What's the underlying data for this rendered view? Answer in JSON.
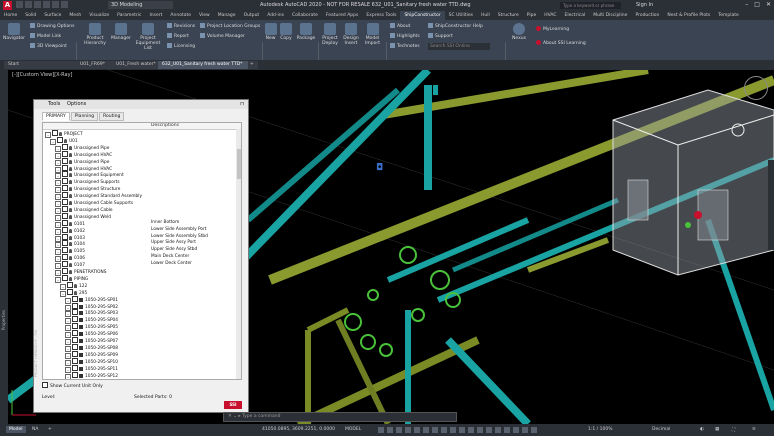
{
  "title_bar": {
    "workspace": "3D Modeling",
    "title": "Autodesk AutoCAD 2020 - NOT FOR RESALE    632_U01_Sanitary fresh water TTD.dwg",
    "search_placeholder": "Type a keyword or phrase",
    "sign_in": "Sign In"
  },
  "ribbon_tabs": [
    "Home",
    "Solid",
    "Surface",
    "Mesh",
    "Visualize",
    "Parametric",
    "Insert",
    "Annotate",
    "View",
    "Manage",
    "Output",
    "Add-ins",
    "Collaborate",
    "Featured Apps",
    "Express Tools",
    "ShipConstructor",
    "SC Utilities",
    "Hull",
    "Structure",
    "Pipe",
    "HVAC",
    "Electrical",
    "Multi Discipline",
    "Production",
    "Nest & Profile Plots",
    "Template"
  ],
  "active_tab": "ShipConstructor",
  "ribbon": {
    "navigator": "Navigator",
    "drawing_options": "Drawing Options",
    "model_link": "Model Link",
    "viewpoint_3d": "3D Viewpoint",
    "product_hierarchy": "Product Hierarchy",
    "manager": "Manager",
    "project_equipment_list": "Project Equipment List",
    "revisions": "Revisions",
    "report": "Report",
    "licensing": "Licensing",
    "project_location_groups": "Project Location Groups",
    "volume_manager": "Volume Manager",
    "new": "New",
    "copy": "Copy",
    "package": "Package",
    "project_deploy": "Project Deploy",
    "design_insert": "Design Insert",
    "model_import": "Model Import",
    "about": "About",
    "highlights": "Highlights",
    "technotes": "Technotes",
    "shipconstructor_help": "ShipConstructor Help",
    "support": "Support",
    "search_ssi_online": "Search SSI Online",
    "nexus": "Nexus",
    "mylearning": "MyLearning",
    "about_ssi_learning": "About SSI Learning",
    "panel_main": "Main",
    "panel_manage": "Manage",
    "panel_project": "Project",
    "panel_workshare": "WorkShare",
    "panel_help": "Help",
    "panel_ssi_learning": "SSI Learning"
  },
  "file_tabs": [
    "Start",
    "U01_FR69*",
    "U01_Fresh water*",
    "632_U01_Sanitary fresh water TTD*"
  ],
  "viewport_label": "[-][Custom View][X-Ray]",
  "left_strip_label": "Properties",
  "panel": {
    "menu_tools": "Tools",
    "menu_options": "Options",
    "tabs": [
      "PRIMARY",
      "Planning",
      "Routing"
    ],
    "col_desc": "Descriptions",
    "rows": [
      {
        "indent": 0,
        "name": "PROJECT",
        "desc": ""
      },
      {
        "indent": 1,
        "name": "U01",
        "desc": ""
      },
      {
        "indent": 2,
        "name": "Unassigned Pipe",
        "desc": ""
      },
      {
        "indent": 2,
        "name": "Unassigned HVAC",
        "desc": ""
      },
      {
        "indent": 2,
        "name": "Unassigned Pipe",
        "desc": ""
      },
      {
        "indent": 2,
        "name": "Unassigned HVAC",
        "desc": ""
      },
      {
        "indent": 2,
        "name": "Unassigned Equipment",
        "desc": ""
      },
      {
        "indent": 2,
        "name": "Unassigned Supports",
        "desc": ""
      },
      {
        "indent": 2,
        "name": "Unassigned Structure",
        "desc": ""
      },
      {
        "indent": 2,
        "name": "Unassigned Standard Assembly",
        "desc": ""
      },
      {
        "indent": 2,
        "name": "Unassigned Cable Supports",
        "desc": ""
      },
      {
        "indent": 2,
        "name": "Unassigned Cable",
        "desc": ""
      },
      {
        "indent": 2,
        "name": "Unassigned Weld",
        "desc": ""
      },
      {
        "indent": 2,
        "name": "0101",
        "desc": "Inner Bottom"
      },
      {
        "indent": 2,
        "name": "0102",
        "desc": "Lower Side Assembly Port"
      },
      {
        "indent": 2,
        "name": "0103",
        "desc": "Lower Side Assembly Stbd"
      },
      {
        "indent": 2,
        "name": "0104",
        "desc": "Upper Side Assy Port"
      },
      {
        "indent": 2,
        "name": "0105",
        "desc": "Upper Side Assy Stbd"
      },
      {
        "indent": 2,
        "name": "0106",
        "desc": "Main Deck Center"
      },
      {
        "indent": 2,
        "name": "0107",
        "desc": "Lower Deck Center"
      },
      {
        "indent": 2,
        "name": "PENETRATIONS",
        "desc": ""
      },
      {
        "indent": 2,
        "name": "PIPING",
        "desc": ""
      },
      {
        "indent": 3,
        "name": "122",
        "desc": ""
      },
      {
        "indent": 3,
        "name": "295",
        "desc": ""
      },
      {
        "indent": 4,
        "name": "1050-295-SP01",
        "desc": ""
      },
      {
        "indent": 4,
        "name": "1050-295-SP02",
        "desc": ""
      },
      {
        "indent": 4,
        "name": "1050-295-SP03",
        "desc": ""
      },
      {
        "indent": 4,
        "name": "1050-295-SP04",
        "desc": ""
      },
      {
        "indent": 4,
        "name": "1050-295-SP05",
        "desc": ""
      },
      {
        "indent": 4,
        "name": "1050-295-SP06",
        "desc": ""
      },
      {
        "indent": 4,
        "name": "1050-295-SP07",
        "desc": ""
      },
      {
        "indent": 4,
        "name": "1050-295-SP08",
        "desc": ""
      },
      {
        "indent": 4,
        "name": "1050-295-SP09",
        "desc": ""
      },
      {
        "indent": 4,
        "name": "1050-295-SP10",
        "desc": ""
      },
      {
        "indent": 4,
        "name": "1050-295-SP11",
        "desc": ""
      },
      {
        "indent": 4,
        "name": "1050-295-SP12",
        "desc": ""
      }
    ],
    "show_current_unit": "Show Current Unit Only",
    "level_label": "Level:",
    "selected_parts": "Selected Parts: 0",
    "logo": "SSI",
    "vertical_title": "PRODUCT HIERARCHY - SSI"
  },
  "command_placeholder": "Type a command",
  "status": {
    "tab_model": "Model",
    "tab_layout": "NA",
    "coords": "41050.0895, 3609.2251, 0.0000",
    "mode": "MODEL",
    "scale": "1:1 / 100%",
    "units": "Decimal"
  },
  "colors": {
    "pipe_green": "#8a9a2e",
    "pipe_cyan": "#1aa3a3",
    "valve_green": "#49c23a",
    "ribbon_bg": "#3b4453"
  }
}
